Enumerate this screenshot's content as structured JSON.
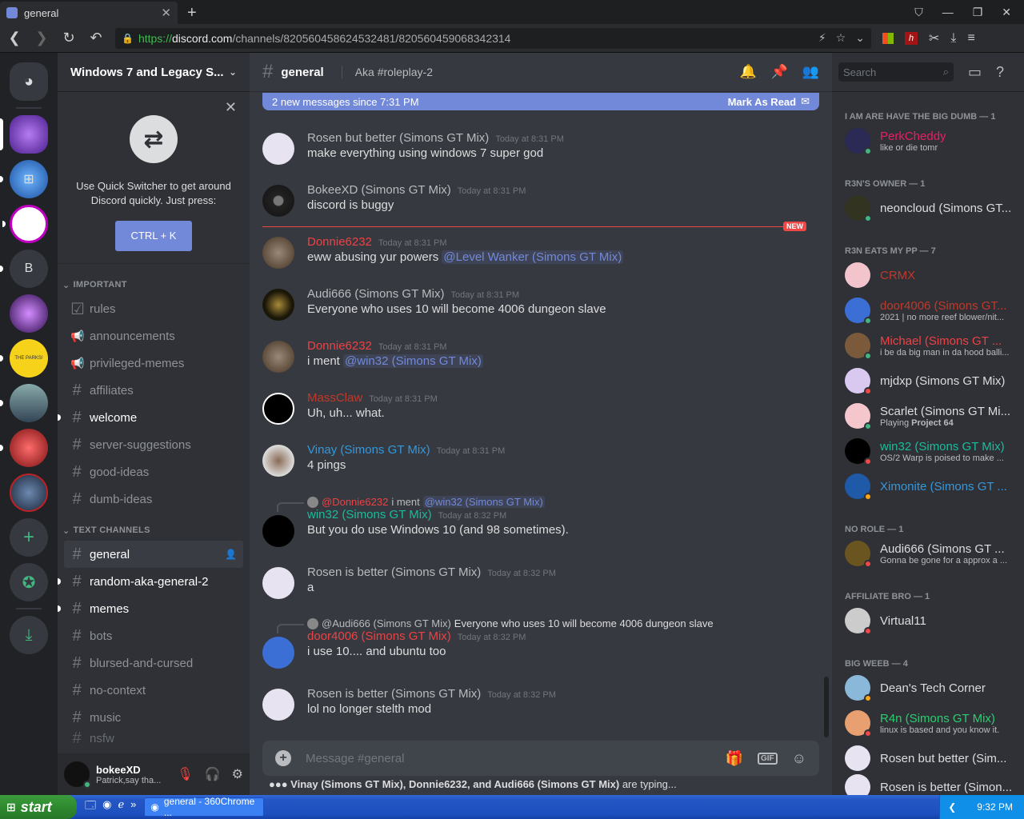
{
  "browser": {
    "tab_title": "general",
    "url_scheme": "https://",
    "url_host": "discord.com",
    "url_path": "/channels/820560458624532481/820560459068342314"
  },
  "guild": {
    "name": "Windows 7 and Legacy S..."
  },
  "servers": {
    "letter_b": "B",
    "yellow_server_text": "THE PARKS!"
  },
  "quick_switcher": {
    "text": "Use Quick Switcher to get around Discord quickly. Just press:",
    "button": "CTRL + K"
  },
  "categories": {
    "important": "IMPORTANT",
    "text_channels": "TEXT CHANNELS"
  },
  "important_channels": [
    {
      "name": "rules"
    },
    {
      "name": "announcements"
    },
    {
      "name": "privileged-memes"
    },
    {
      "name": "affiliates"
    },
    {
      "name": "welcome"
    },
    {
      "name": "server-suggestions"
    },
    {
      "name": "good-ideas"
    },
    {
      "name": "dumb-ideas"
    }
  ],
  "text_channels": [
    {
      "name": "general"
    },
    {
      "name": "random-aka-general-2"
    },
    {
      "name": "memes"
    },
    {
      "name": "bots"
    },
    {
      "name": "blursed-and-cursed"
    },
    {
      "name": "no-context"
    },
    {
      "name": "music"
    },
    {
      "name": "nsfw"
    }
  ],
  "user": {
    "name": "bokeeXD",
    "status": "Patrick,say tha..."
  },
  "chat": {
    "channel": "general",
    "topic": "Aka #roleplay-2",
    "new_bar": "2 new messages since 7:31 PM",
    "mark_read": "Mark As Read",
    "new_label": "NEW",
    "placeholder": "Message #general",
    "gif": "GIF",
    "typing_users": "Vinay (Simons GT Mix), Donnie6232, and Audi666 (Simons GT Mix)",
    "typing_suffix": " are typing..."
  },
  "messages": [
    {
      "author": "Rosen but better (Simons GT Mix)",
      "time": "Today at 8:31 PM",
      "text": "make everything using windows 7 super god"
    },
    {
      "author": "BokeeXD (Simons GT Mix)",
      "time": "Today at 8:31 PM",
      "text": "discord is buggy"
    },
    {
      "author": "Donnie6232",
      "time": "Today at 8:31 PM",
      "text": "eww abusing yur powers ",
      "mention": "@Level Wanker (Simons GT Mix)"
    },
    {
      "author": "Audi666 (Simons GT Mix)",
      "time": "Today at 8:31 PM",
      "text": "Everyone who uses 10 will become 4006 dungeon slave"
    },
    {
      "author": "Donnie6232",
      "time": "Today at 8:31 PM",
      "text": "i ment ",
      "mention": "@win32 (Simons GT Mix)"
    },
    {
      "author": "MassClaw",
      "time": "Today at 8:31 PM",
      "text": "Uh, uh... what."
    },
    {
      "author": "Vinay (Simons GT Mix)",
      "time": "Today at 8:31 PM",
      "text": "4 pings"
    },
    {
      "author": "win32 (Simons GT Mix)",
      "time": "Today at 8:32 PM",
      "text": "But you do use Windows 10 (and 98 sometimes).",
      "reply_author": "@Donnie6232",
      "reply_text": "i ment",
      "reply_mention": "@win32 (Simons GT Mix)"
    },
    {
      "author": "Rosen is better (Simons GT Mix)",
      "time": "Today at 8:32 PM",
      "text": "a"
    },
    {
      "author": "door4006 (Simons GT Mix)",
      "time": "Today at 8:32 PM",
      "text": "i use 10.... and ubuntu too",
      "reply_author": "@Audi666 (Simons GT Mix)",
      "reply_text": "Everyone who uses 10 will become 4006 dungeon slave"
    },
    {
      "author": "Rosen is better (Simons GT Mix)",
      "time": "Today at 8:32 PM",
      "text": "lol no longer stelth mod"
    }
  ],
  "members_panel": {
    "search_placeholder": "Search",
    "groups": [
      {
        "title": "I AM ARE HAVE THE BIG DUMB — 1"
      },
      {
        "title": "R3N'S OWNER — 1"
      },
      {
        "title": "R3N EATS MY PP — 7"
      },
      {
        "title": "NO ROLE — 1"
      },
      {
        "title": "AFFILIATE BRO — 1"
      },
      {
        "title": "BIG WEEB — 4"
      }
    ],
    "members": [
      {
        "name": "PerkCheddy",
        "status": "like or die tomr",
        "color": "#e91e63"
      },
      {
        "name": "neoncloud (Simons GT...",
        "color": "#dcddde"
      },
      {
        "name": "CRMX",
        "color": "#e74c3c"
      },
      {
        "name": "door4006 (Simons GT...",
        "status": "2021 | no more reef blower/nit...",
        "color": "#e74c3c"
      },
      {
        "name": "Michael (Simons GT ...",
        "status": "i be da big man in da hood balli...",
        "color": "#e74c3c"
      },
      {
        "name": "mjdxp (Simons GT Mix)",
        "color": "#dcddde"
      },
      {
        "name": "Scarlet (Simons GT Mi...",
        "status_prefix": "Playing ",
        "status": "Project 64",
        "color": "#dcddde"
      },
      {
        "name": "win32 (Simons GT Mix)",
        "status": "OS/2 Warp is poised to make ...",
        "color": "#1abc9c"
      },
      {
        "name": "Ximonite (Simons GT ...",
        "color": "#3498db"
      },
      {
        "name": "Audi666 (Simons GT ...",
        "status": "Gonna be gone for a approx a ...",
        "color": "#dcddde"
      },
      {
        "name": "Virtual11",
        "color": "#dcddde"
      },
      {
        "name": "Dean's Tech Corner",
        "color": "#dcddde"
      },
      {
        "name": "R4n (Simons GT Mix)",
        "status": "linux is based and you know it.",
        "color": "#2ecc71"
      },
      {
        "name": "Rosen but better (Sim...",
        "color": "#dcddde"
      },
      {
        "name": "Rosen is better (Simon...",
        "color": "#dcddde"
      }
    ]
  },
  "colors": {
    "blurple": "#7289da",
    "red_author": "#ed4245",
    "green_author": "#1abc9c",
    "blue_author": "#3498db",
    "default_author": "#b9bbbe"
  },
  "taskbar": {
    "start": "start",
    "task": "general - 360Chrome ...",
    "clock": "9:32 PM"
  }
}
